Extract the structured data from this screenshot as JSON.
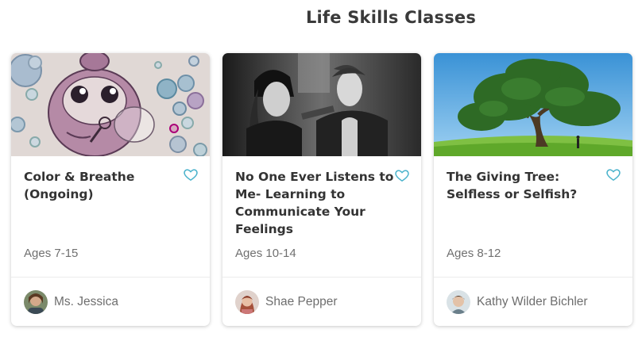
{
  "section": {
    "title": "Life Skills Classes"
  },
  "colors": {
    "accent": "#4bb3cc",
    "card_bg": "#ffffff",
    "title_text": "#333333",
    "muted_text": "#707070"
  },
  "cards": [
    {
      "image": "bubble-blowing-cartoon-illustration",
      "title": "Color & Breathe (Ongoing)",
      "ages": "Ages 7-15",
      "teacher": "Ms. Jessica",
      "favorite_icon": "heart-outline-icon"
    },
    {
      "image": "two-teens-black-and-white-photo",
      "title": "No One Ever Listens to Me- Learning to Communicate Your Feelings",
      "ages": "Ages 10-14",
      "teacher": "Shae Pepper",
      "favorite_icon": "heart-outline-icon"
    },
    {
      "image": "large-tree-on-grass-hill-photo",
      "title": "The Giving Tree: Selfless or Selfish?",
      "ages": "Ages 8-12",
      "teacher": "Kathy Wilder Bichler",
      "favorite_icon": "heart-outline-icon"
    }
  ]
}
